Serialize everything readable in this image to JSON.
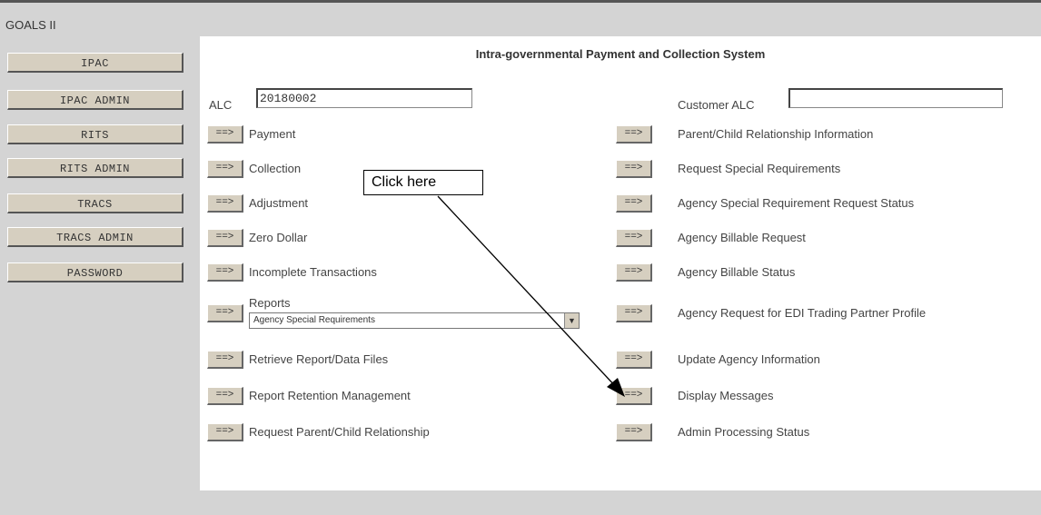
{
  "app": {
    "title": "GOALS II"
  },
  "nav": [
    {
      "label": "IPAC"
    },
    {
      "label": "IPAC ADMIN"
    },
    {
      "label": "RITS"
    },
    {
      "label": "RITS ADMIN"
    },
    {
      "label": "TRACS"
    },
    {
      "label": "TRACS ADMIN"
    },
    {
      "label": "PASSWORD"
    }
  ],
  "main": {
    "heading": "Intra-governmental Payment and Collection System",
    "alc_label": "ALC",
    "alc_value": "20180002",
    "customer_alc_label": "Customer ALC",
    "customer_alc_value": "",
    "arrow_label": "==>",
    "left_items": [
      "Payment",
      "Collection",
      "Adjustment",
      "Zero Dollar",
      "Incomplete Transactions",
      "Reports",
      "Retrieve Report/Data Files",
      "Report Retention Management",
      "Request Parent/Child Relationship"
    ],
    "reports_select": "Agency Special Requirements",
    "right_items": [
      "Parent/Child Relationship Information",
      "Request Special Requirements",
      "Agency Special Requirement Request Status",
      "Agency Billable Request",
      "Agency Billable Status",
      "Agency Request for EDI Trading Partner Profile",
      "Update Agency Information",
      "Display Messages",
      "Admin Processing Status"
    ]
  },
  "callout": {
    "text": "Click here"
  }
}
